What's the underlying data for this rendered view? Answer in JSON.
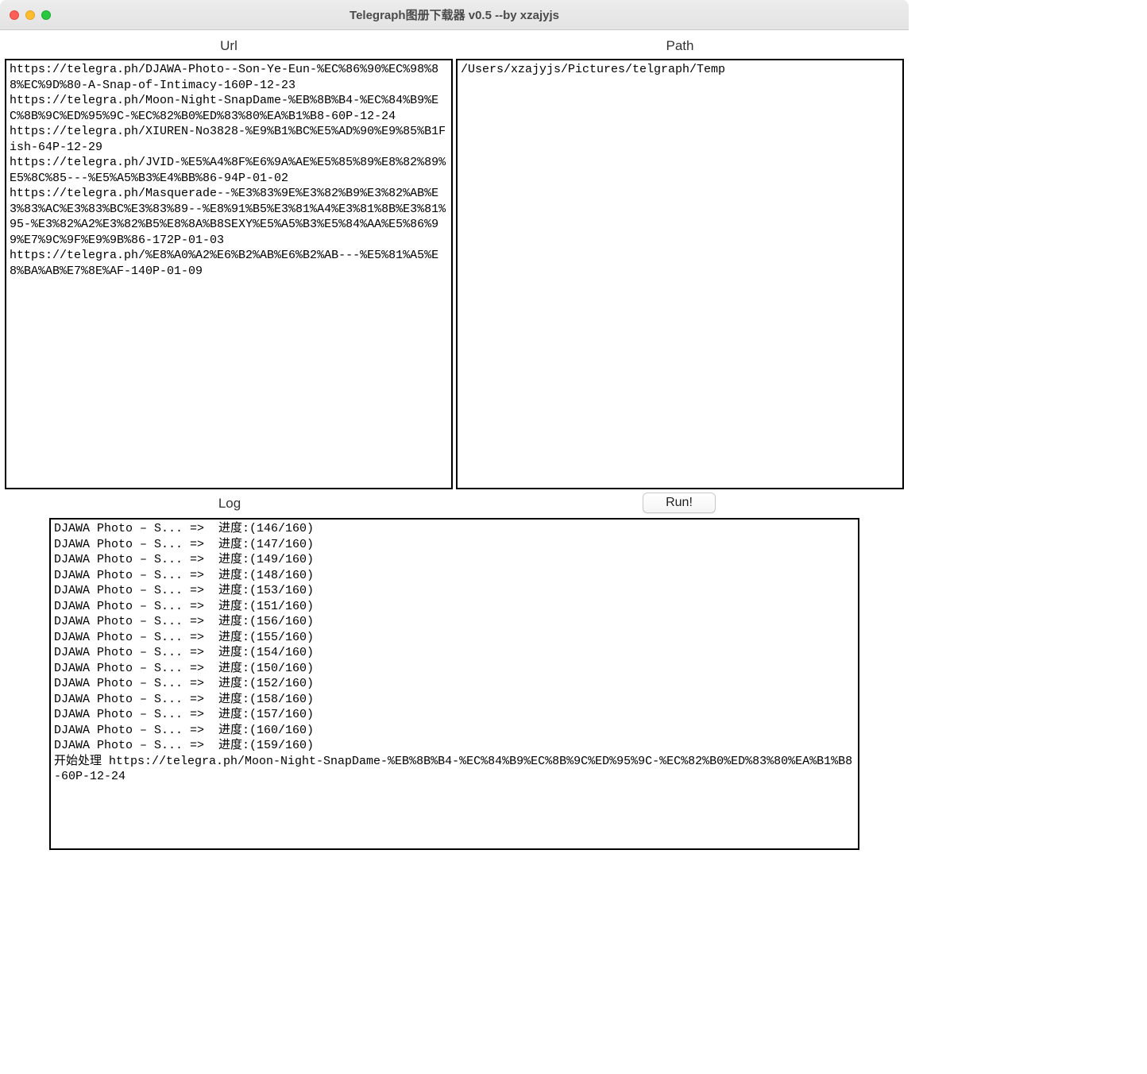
{
  "window": {
    "title": "Telegraph图册下载器 v0.5 --by xzajyjs"
  },
  "labels": {
    "url": "Url",
    "path": "Path",
    "log": "Log",
    "run": "Run!"
  },
  "inputs": {
    "url_value": "https://telegra.ph/DJAWA-Photo--Son-Ye-Eun-%EC%86%90%EC%98%88%EC%9D%80-A-Snap-of-Intimacy-160P-12-23\nhttps://telegra.ph/Moon-Night-SnapDame-%EB%8B%B4-%EC%84%B9%EC%8B%9C%ED%95%9C-%EC%82%B0%ED%83%80%EA%B1%B8-60P-12-24\nhttps://telegra.ph/XIUREN-No3828-%E9%B1%BC%E5%AD%90%E9%85%B1Fish-64P-12-29\nhttps://telegra.ph/JVID-%E5%A4%8F%E6%9A%AE%E5%85%89%E8%82%89%E5%8C%85---%E5%A5%B3%E4%BB%86-94P-01-02\nhttps://telegra.ph/Masquerade--%E3%83%9E%E3%82%B9%E3%82%AB%E3%83%AC%E3%83%BC%E3%83%89--%E8%91%B5%E3%81%A4%E3%81%8B%E3%81%95-%E3%82%A2%E3%82%B5%E8%8A%B8SEXY%E5%A5%B3%E5%84%AA%E5%86%99%E7%9C%9F%E9%9B%86-172P-01-03\nhttps://telegra.ph/%E8%A0%A2%E6%B2%AB%E6%B2%AB---%E5%81%A5%E8%BA%AB%E7%8E%AF-140P-01-09",
    "path_value": "/Users/xzajyjs/Pictures/telgraph/Temp"
  },
  "log_lines": [
    "DJAWA Photo – S... =>  进度:(146/160)",
    "DJAWA Photo – S... =>  进度:(147/160)",
    "DJAWA Photo – S... =>  进度:(149/160)",
    "DJAWA Photo – S... =>  进度:(148/160)",
    "DJAWA Photo – S... =>  进度:(153/160)",
    "DJAWA Photo – S... =>  进度:(151/160)",
    "DJAWA Photo – S... =>  进度:(156/160)",
    "DJAWA Photo – S... =>  进度:(155/160)",
    "DJAWA Photo – S... =>  进度:(154/160)",
    "DJAWA Photo – S... =>  进度:(150/160)",
    "DJAWA Photo – S... =>  进度:(152/160)",
    "DJAWA Photo – S... =>  进度:(158/160)",
    "DJAWA Photo – S... =>  进度:(157/160)",
    "DJAWA Photo – S... =>  进度:(160/160)",
    "DJAWA Photo – S... =>  进度:(159/160)",
    "开始处理 https://telegra.ph/Moon-Night-SnapDame-%EB%8B%B4-%EC%84%B9%EC%8B%9C%ED%95%9C-%EC%82%B0%ED%83%80%EA%B1%B8-60P-12-24"
  ]
}
